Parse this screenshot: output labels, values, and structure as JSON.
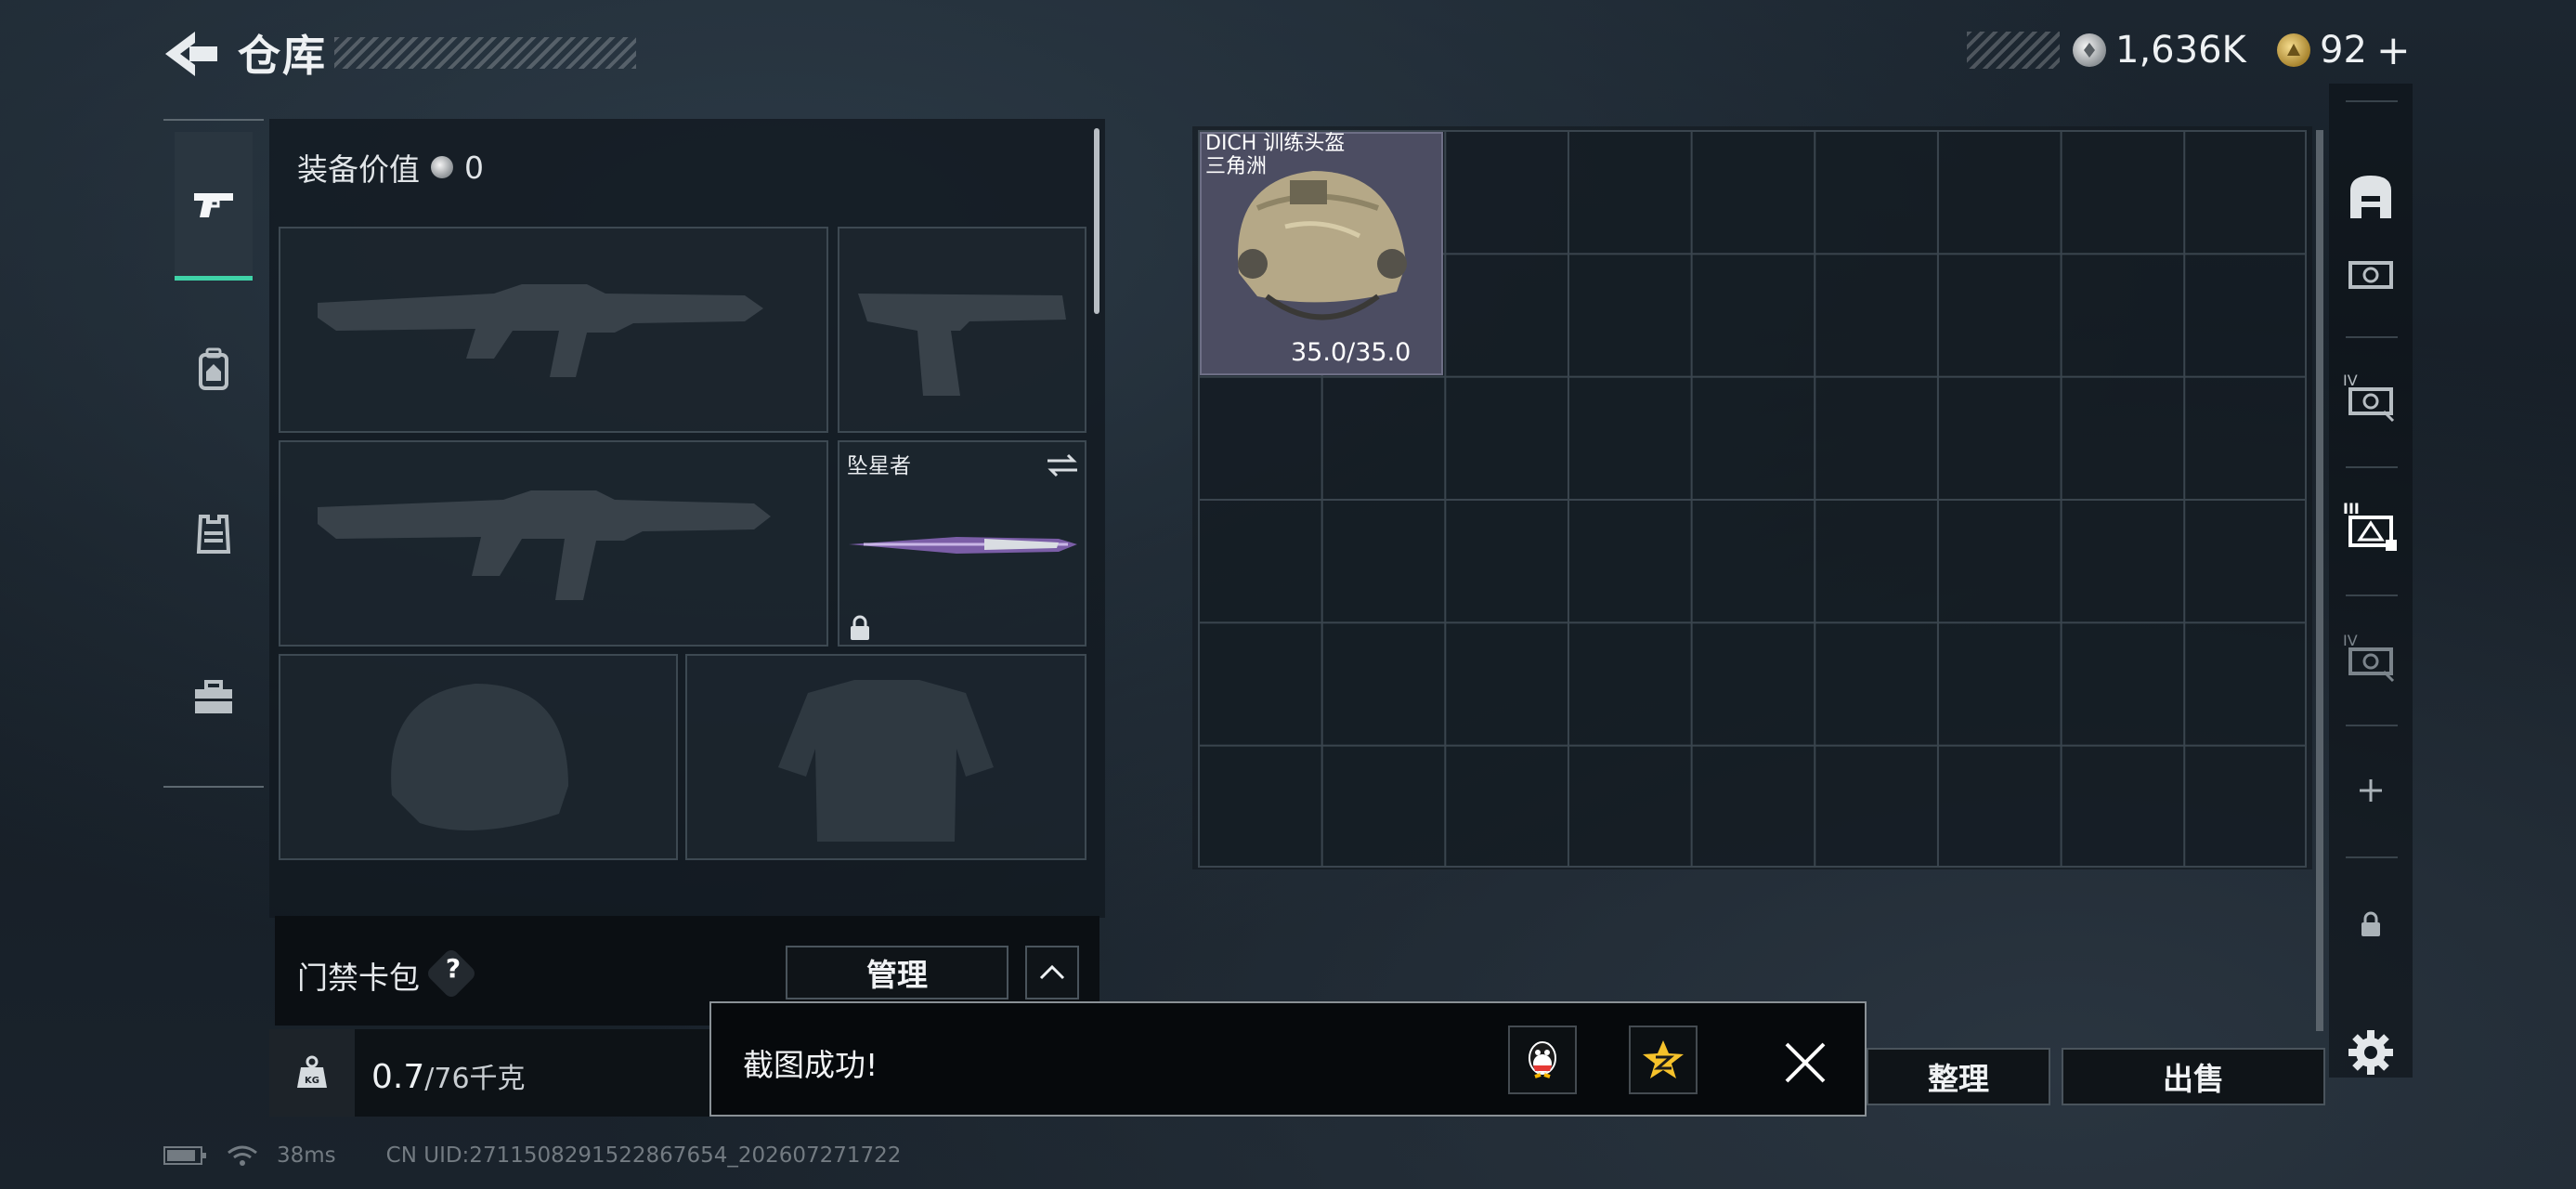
{
  "header": {
    "title": "仓库",
    "currencies": [
      {
        "icon": "silver-coin-icon",
        "value": "1,636K"
      },
      {
        "icon": "gold-coin-icon",
        "value": "92"
      }
    ],
    "add_label": "+"
  },
  "left_tabs": [
    {
      "icon": "pistol-icon",
      "active": true
    },
    {
      "icon": "backpack-icon",
      "active": false
    },
    {
      "icon": "vest-icon",
      "active": false
    },
    {
      "icon": "toolbox-icon",
      "active": false
    }
  ],
  "loadout": {
    "equipment_value_label": "装备价值",
    "equipment_value": "0",
    "melee_name": "坠星者"
  },
  "keycard": {
    "label": "门禁卡包",
    "help": "?",
    "manage_label": "管理"
  },
  "weight": {
    "icon_text": "KG",
    "current": "0.7",
    "max": "/76千克"
  },
  "storage": {
    "columns": 9,
    "rows": 6,
    "items": [
      {
        "name": "DICH 训练头盔",
        "map": "三角洲",
        "durability": "35.0/35.0",
        "icon": "helmet-icon",
        "rarity_color": "#4c4d62"
      }
    ]
  },
  "right_rail": {
    "items": [
      "all-icon",
      "tier-v-box-icon",
      "tier-iv-box-icon",
      "tier-iii-box-icon",
      "tier-iv-box-icon-2",
      "add-icon",
      "lock-icon"
    ],
    "settings_icon": "gear-icon"
  },
  "buttons": {
    "sort_label": "整理",
    "sell_label": "出售"
  },
  "toast": {
    "message": "截图成功!",
    "share_targets": [
      "qq-icon",
      "qzone-icon"
    ]
  },
  "status": {
    "ping": "38ms",
    "uid": "CN UID:2711508291522867654_202607271722"
  },
  "colors": {
    "accent": "#3fd3a8",
    "item_background": "#4c4d62"
  }
}
